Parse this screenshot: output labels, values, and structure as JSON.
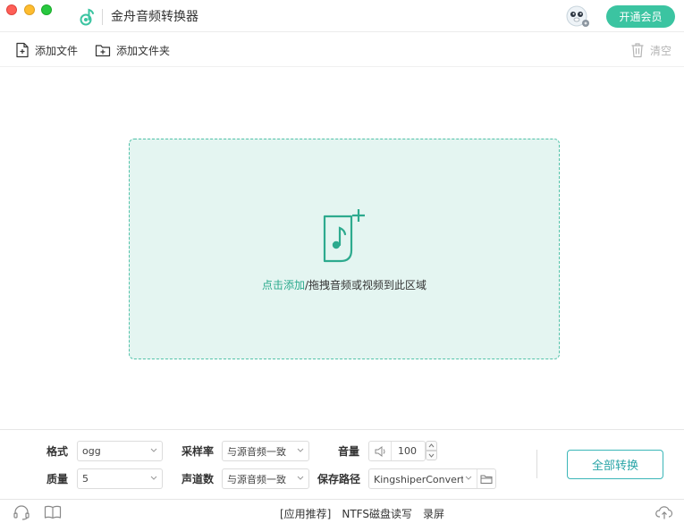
{
  "window": {
    "title": "金舟音频转换器",
    "vip_label": "开通会员",
    "colors": {
      "accent": "#3bc4a1",
      "drop_bg": "#e4f5f1",
      "drop_border": "#52c2a9",
      "link": "#2daa8e"
    }
  },
  "toolbar": {
    "add_file": "添加文件",
    "add_folder": "添加文件夹",
    "clear": "清空"
  },
  "dropzone": {
    "link_text": "点击添加",
    "hint_text": "/拖拽音频或视频到此区域",
    "icon": "music-file-add-icon"
  },
  "settings": {
    "format": {
      "label": "格式",
      "value": "ogg"
    },
    "quality": {
      "label": "质量",
      "value": "5"
    },
    "sample_rate": {
      "label": "采样率",
      "value": "与源音频一致"
    },
    "channels": {
      "label": "声道数",
      "value": "与源音频一致"
    },
    "volume": {
      "label": "音量",
      "value": "100"
    },
    "save_path": {
      "label": "保存路径",
      "value": "KingshiperConverter"
    },
    "convert_all": "全部转换"
  },
  "footer": {
    "links": [
      "[应用推荐]",
      "NTFS磁盘读写",
      "录屏"
    ]
  }
}
